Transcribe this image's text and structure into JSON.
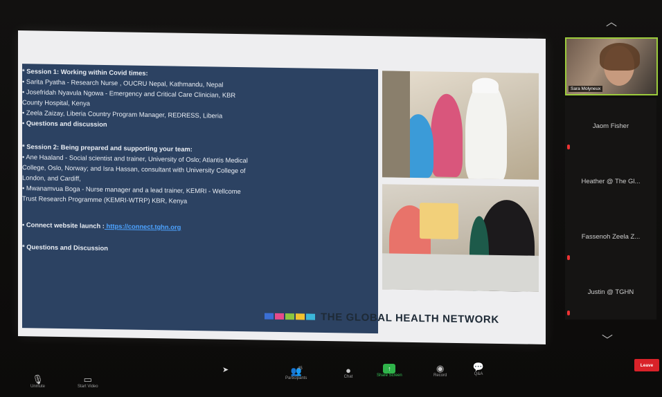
{
  "slide": {
    "agenda": [
      {
        "text": "* Session 1: Working within Covid times:",
        "bold": true
      },
      {
        "text": "•   Sarita Pyatha - Research Nurse , OUCRU Nepal, Kathmandu, Nepal",
        "bold": false
      },
      {
        "text": "•   Josefridah Nyavula Ngowa - Emergency and Critical Care Clinician, KBR",
        "bold": false
      },
      {
        "text": "      County Hospital, Kenya",
        "bold": false
      },
      {
        "text": "•   Zeela Zaizay, Liberia Country Program Manager, REDRESS, Liberia",
        "bold": false
      },
      {
        "text": "•   Questions and discussion",
        "bold": true
      },
      {
        "text": "* Session 2: Being prepared and supporting your team:",
        "bold": true
      },
      {
        "text": "•   Ane Haaland - Social scientist and trainer, University of Oslo; Atlantis Medical",
        "bold": false
      },
      {
        "text": "      College, Oslo, Norway; and Isra Hassan,  consultant with University College of",
        "bold": false
      },
      {
        "text": "      London, and Cardiff,",
        "bold": false
      },
      {
        "text": "•   Mwanamvua Boga - Nurse manager and a lead trainer, KEMRI - Wellcome",
        "bold": false
      },
      {
        "text": "      Trust Research Programme (KEMRI-WTRP) KBR, Kenya",
        "bold": false
      },
      {
        "text": "•   Connect website launch :",
        "bold": true
      },
      {
        "text": "* Questions and Discussion",
        "bold": true
      }
    ],
    "link": "https://connect.tghn.org",
    "logo_text": "THE GLOBAL HEALTH NETWORK",
    "logo_colors": [
      "#3b6fd4",
      "#e64b8b",
      "#8cc63f",
      "#f2c12e",
      "#3bb6d9"
    ]
  },
  "participants": {
    "self_name": "Sara Molyneux",
    "tiles": [
      "Jaom Fisher",
      "Heather @ The Gl...",
      "Fassenoh Zeela Z...",
      "Justin @ TGHN"
    ]
  },
  "toolbar": {
    "unmute": "Unmute",
    "start_video": "Start Video",
    "participants": "Participants",
    "participant_count": "45",
    "chat": "Chat",
    "share_screen": "Share Screen",
    "record": "Record",
    "qa": "Q&A",
    "leave": "Leave"
  },
  "colors": {
    "agenda_bg": "#2c4262",
    "accent_green": "#2fb34a",
    "leave_red": "#d92229"
  },
  "icons": [
    "mic-muted-icon",
    "video-off-icon",
    "participants-icon",
    "chat-icon",
    "share-screen-icon",
    "record-icon",
    "qa-icon",
    "chevron-up-icon",
    "chevron-down-icon",
    "cursor-icon"
  ]
}
